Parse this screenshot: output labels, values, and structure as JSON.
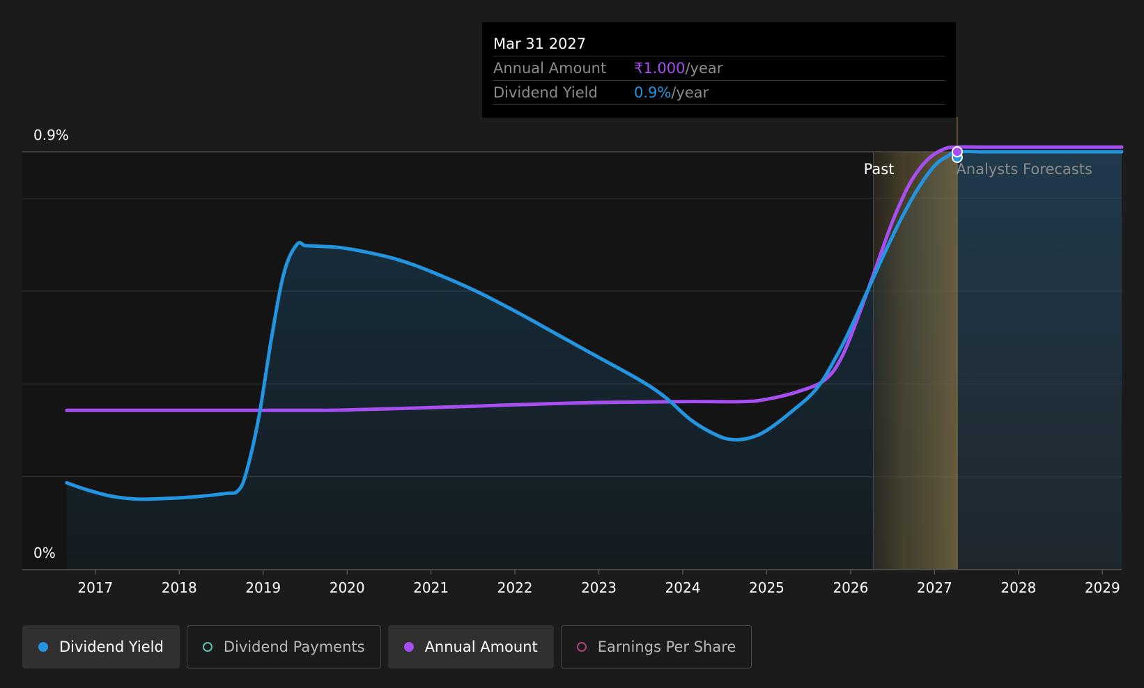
{
  "chart_data": {
    "type": "line",
    "y_axis": {
      "min_label": "0%",
      "max_label": "0.9%",
      "ylim": [
        0,
        0.9
      ]
    },
    "x_ticks": [
      "2017",
      "2018",
      "2019",
      "2020",
      "2021",
      "2022",
      "2023",
      "2024",
      "2025",
      "2026",
      "2027",
      "2028",
      "2029"
    ],
    "xlim": [
      2016.13,
      2029.23
    ],
    "past_label": "Past",
    "forecast_label": "Analysts Forecasts",
    "past_region": [
      2026.27,
      2026.66
    ],
    "forecast_region": [
      2026.66,
      2027.27
    ],
    "series": [
      {
        "name": "Dividend Yield",
        "color": "#2394df",
        "x": [
          2016.66,
          2016.9,
          2017.2,
          2017.5,
          2017.8,
          2018.2,
          2018.55,
          2018.7,
          2018.8,
          2018.95,
          2019.1,
          2019.25,
          2019.4,
          2019.5,
          2019.6,
          2019.9,
          2020.2,
          2020.6,
          2021.0,
          2021.5,
          2022.0,
          2022.5,
          2023.0,
          2023.5,
          2023.8,
          2024.1,
          2024.4,
          2024.6,
          2024.8,
          2025.0,
          2025.3,
          2025.6,
          2025.85,
          2026.0,
          2026.2,
          2026.4,
          2026.6,
          2026.8,
          2027.0,
          2027.15,
          2027.27,
          2027.6,
          2028.0,
          2029.23
        ],
        "y": [
          0.187,
          0.172,
          0.158,
          0.152,
          0.153,
          0.157,
          0.164,
          0.17,
          0.21,
          0.33,
          0.5,
          0.64,
          0.7,
          0.698,
          0.697,
          0.694,
          0.685,
          0.668,
          0.642,
          0.603,
          0.557,
          0.507,
          0.457,
          0.407,
          0.37,
          0.322,
          0.29,
          0.28,
          0.284,
          0.3,
          0.341,
          0.391,
          0.466,
          0.52,
          0.6,
          0.68,
          0.755,
          0.82,
          0.87,
          0.89,
          0.9,
          0.9,
          0.9,
          0.9
        ]
      },
      {
        "name": "Annual Amount",
        "color": "#a64ef0",
        "x": [
          2016.66,
          2017.5,
          2018.5,
          2019.5,
          2020.0,
          2021.0,
          2022.0,
          2023.0,
          2024.0,
          2024.7,
          2025.0,
          2025.4,
          2025.7,
          2025.9,
          2026.1,
          2026.3,
          2026.5,
          2026.7,
          2026.9,
          2027.1,
          2027.27,
          2027.6,
          2028.0,
          2029.23
        ],
        "y": [
          0.343,
          0.343,
          0.343,
          0.343,
          0.344,
          0.349,
          0.355,
          0.36,
          0.362,
          0.362,
          0.367,
          0.385,
          0.41,
          0.46,
          0.55,
          0.65,
          0.75,
          0.83,
          0.88,
          0.905,
          0.91,
          0.91,
          0.91,
          0.91
        ]
      }
    ],
    "highlight_point": {
      "x": 2027.27
    }
  },
  "tooltip": {
    "date": "Mar 31 2027",
    "rows": [
      {
        "label": "Annual Amount",
        "value": "₹1.000",
        "unit": "/year",
        "color": "#a64ef0"
      },
      {
        "label": "Dividend Yield",
        "value": "0.9%",
        "unit": "/year",
        "color": "#2394df"
      }
    ]
  },
  "legend": [
    {
      "label": "Dividend Yield",
      "color": "#2394df",
      "active": true,
      "filled": true
    },
    {
      "label": "Dividend Payments",
      "color": "#5dc1b8",
      "active": false,
      "filled": false
    },
    {
      "label": "Annual Amount",
      "color": "#a64ef0",
      "active": true,
      "filled": true
    },
    {
      "label": "Earnings Per Share",
      "color": "#b0427c",
      "active": false,
      "filled": false
    }
  ]
}
